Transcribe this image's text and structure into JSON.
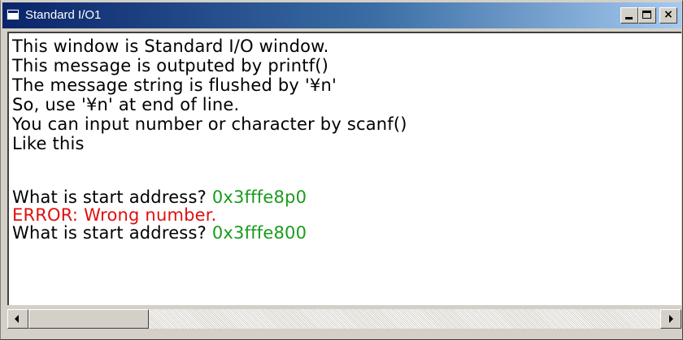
{
  "window": {
    "title": "Standard I/O1",
    "accent_color": "#0a246a"
  },
  "controls": {
    "minimize_icon": "minimize-icon",
    "maximize_icon": "maximize-icon",
    "close_label": "×"
  },
  "console": {
    "lines": [
      {
        "text": "This window is Standard I/O window.",
        "kind": "output"
      },
      {
        "text": "This message is outputed by printf()",
        "kind": "output"
      },
      {
        "text": "The message string is flushed by '¥n'",
        "kind": "output"
      },
      {
        "text": "So, use '¥n' at end of line.",
        "kind": "output"
      },
      {
        "text": "You can input number or character by scanf()",
        "kind": "output"
      },
      {
        "text": "Like this",
        "kind": "output"
      },
      {
        "text": "",
        "kind": "blank"
      },
      {
        "prompt": "What is start address? ",
        "input": "0x3fffe8p0",
        "kind": "prompt"
      },
      {
        "text": "ERROR: Wrong number.",
        "kind": "error"
      },
      {
        "prompt": "What is start address? ",
        "input": "0x3fffe800",
        "kind": "prompt"
      }
    ],
    "colors": {
      "output": "#000000",
      "input": "#1a9b1a",
      "error": "#e01010"
    }
  },
  "scrollbar": {
    "left_icon": "scroll-left-icon",
    "right_icon": "scroll-right-icon",
    "position": 0.0
  }
}
